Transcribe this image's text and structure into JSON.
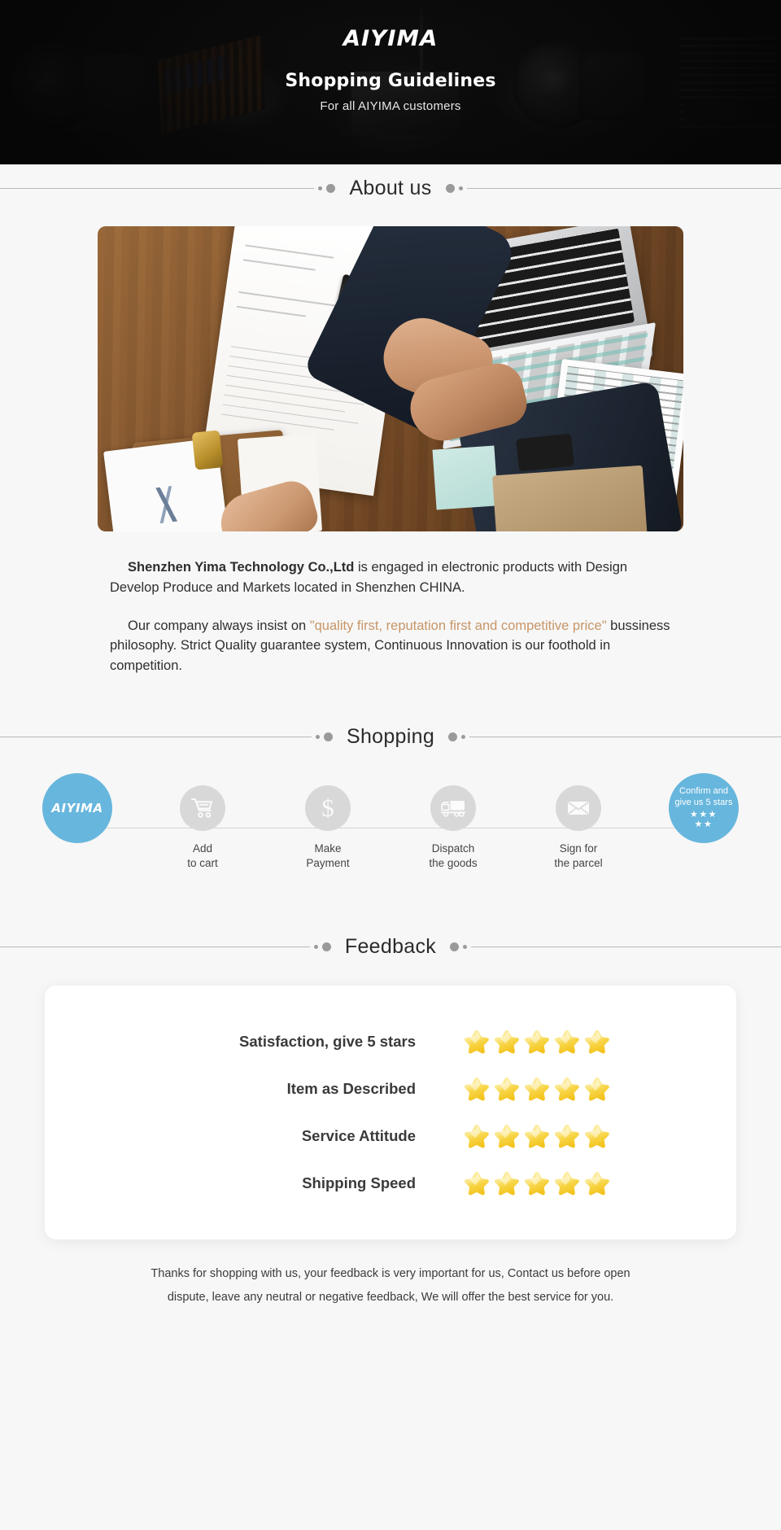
{
  "banner": {
    "logo": "AIYIMA",
    "title": "Shopping Guidelines",
    "subtitle": "For all AIYIMA customers"
  },
  "sections": {
    "about_title": "About us",
    "shopping_title": "Shopping",
    "feedback_title": "Feedback"
  },
  "about": {
    "photo_alt": "business-handshake-over-desk-photo",
    "p1_bold": "Shenzhen Yima Technology Co.,Ltd",
    "p1_rest": " is engaged in electronic products with Design Develop Produce and Markets located in Shenzhen CHINA.",
    "p2_before": "Our company always insist on ",
    "p2_quote": "\"quality first, reputation first and competitive price\"",
    "p2_after": " bussiness philosophy. Strict Quality guarantee system, Continuous Innovation is our foothold in competition.",
    "accent_color": "#c79668"
  },
  "shopping": {
    "accent_color": "#67b6dd",
    "steps": [
      {
        "icon": "aiyima-logo-icon",
        "brand": "AIYIMA",
        "label_line1": "",
        "label_line2": ""
      },
      {
        "icon": "shopping-cart-icon",
        "label_line1": "Add",
        "label_line2": "to cart"
      },
      {
        "icon": "dollar-sign-icon",
        "label_line1": "Make",
        "label_line2": "Payment"
      },
      {
        "icon": "delivery-truck-icon",
        "label_line1": "Dispatch",
        "label_line2": "the goods"
      },
      {
        "icon": "envelope-icon",
        "label_line1": "Sign for",
        "label_line2": "the parcel"
      }
    ],
    "final_step": {
      "icon": "five-stars-icon",
      "line1": "Confirm and",
      "line2": "give us 5 stars",
      "stars_top": "★★★",
      "stars_bottom": "★★"
    }
  },
  "feedback": {
    "rows": [
      {
        "label": "Satisfaction, give 5 stars",
        "stars": 5
      },
      {
        "label": "Item as Described",
        "stars": 5
      },
      {
        "label": "Service Attitude",
        "stars": 5
      },
      {
        "label": "Shipping Speed",
        "stars": 5
      }
    ],
    "star_color": "#f7d94c"
  },
  "footer": {
    "line1": "Thanks for shopping with us, your feedback is very important for us, Contact us before open",
    "line2": "dispute, leave any neutral or negative feedback, We will offer the best service for you."
  }
}
